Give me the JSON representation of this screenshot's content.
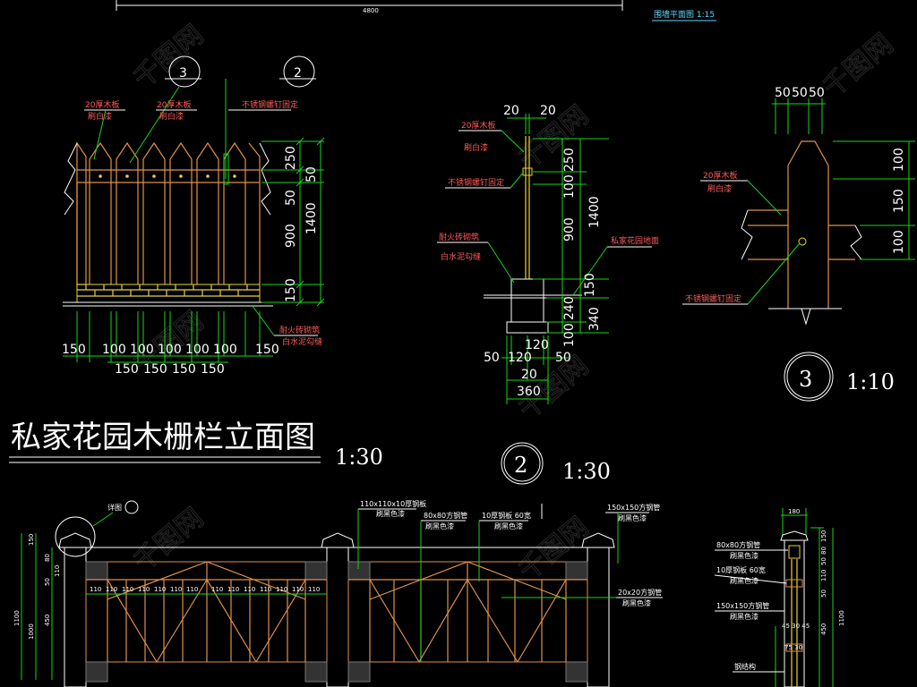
{
  "title": "私家花园木栅栏立面图",
  "title_scale": "1:30",
  "top_note": "围墙平面图 1:15",
  "top_dim": "4800",
  "detail2": {
    "badge": "2",
    "scale": "1:30",
    "top_dims": [
      "20",
      "20"
    ],
    "v_dims_left": [
      "250",
      "100",
      "900",
      "150",
      "240",
      "100"
    ],
    "v_dims_right": [
      "1400",
      "340"
    ],
    "bottom_dims": [
      "120",
      "50",
      "120",
      "50",
      "20",
      "360"
    ],
    "notes": [
      "20厚木板",
      "刷白漆",
      "不锈钢螺钉固定",
      "耐火砖砌筑",
      "白水泥勾缝",
      "私家花园地面"
    ]
  },
  "detail3": {
    "badge": "3",
    "scale": "1:10",
    "top_dims": [
      "50",
      "50",
      "50"
    ],
    "v_dims": [
      "100",
      "150",
      "100"
    ],
    "notes": [
      "20厚木板",
      "刷白漆",
      "不锈钢螺钉固定"
    ]
  },
  "elevation": {
    "badges": [
      "3",
      "2"
    ],
    "v_dims_left": [
      "250",
      "50",
      "900",
      "150"
    ],
    "v_dims_right": [
      "50",
      "1400"
    ],
    "bottom_row1": [
      "150",
      "100",
      "100",
      "100",
      "100",
      "100",
      "150"
    ],
    "bottom_row2": [
      "150",
      "150",
      "150",
      "150"
    ],
    "notes": [
      "20厚木板",
      "刷白漆",
      "20厚木板",
      "刷白漆",
      "不锈钢螺钉固定",
      "耐火砖砌筑",
      "白水泥勾缝"
    ]
  },
  "bottom_fence": {
    "callouts": [
      "110x110x10厚钢板",
      "刷黑色漆",
      "80x80方钢管",
      "刷黑色漆",
      "10厚钢板 60宽",
      "刷黑色漆",
      "150x150方钢管",
      "刷黑色漆",
      "20x20方钢管",
      "刷黑色漆"
    ],
    "left_dims": [
      "150",
      "80",
      "110",
      "50",
      "450",
      "1100",
      "1000"
    ],
    "row_dims": [
      "110",
      "110",
      "110",
      "110",
      "110",
      "110",
      "110",
      "110",
      "110",
      "110",
      "110",
      "110",
      "110",
      "110"
    ],
    "label_left": "详图"
  },
  "side_section": {
    "top_dim": "180",
    "callouts": [
      "80x80方钢管",
      "刷黑色漆",
      "10厚钢板 60宽",
      "刷黑色漆",
      "150x150方钢管",
      "刷黑色漆",
      "钢结构"
    ],
    "dims": [
      "150",
      "80",
      "50",
      "110",
      "50",
      "450",
      "1100",
      "45 30 45",
      "75 30"
    ]
  },
  "watermark": "千图网"
}
